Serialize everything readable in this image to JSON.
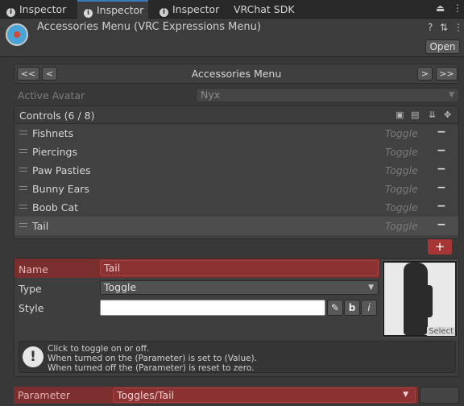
{
  "tabs": [
    {
      "label": "Inspector",
      "icon": "info-icon"
    },
    {
      "label": "Inspector",
      "icon": "info-icon"
    },
    {
      "label": "Inspector",
      "icon": "info-icon"
    },
    {
      "label": "VRChat SDK"
    }
  ],
  "header": {
    "title": "Accessories Menu (VRC Expressions Menu)",
    "open_label": "Open"
  },
  "nav": {
    "first": "<<",
    "prev": "<",
    "title": "Accessories Menu",
    "next": ">",
    "last": ">>"
  },
  "avatar": {
    "label": "Active Avatar",
    "value": "Nyx"
  },
  "controls": {
    "label": "Controls (6 / 8)",
    "items": [
      {
        "name": "Fishnets",
        "type": "Toggle"
      },
      {
        "name": "Piercings",
        "type": "Toggle"
      },
      {
        "name": "Paw Pasties",
        "type": "Toggle"
      },
      {
        "name": "Bunny Ears",
        "type": "Toggle"
      },
      {
        "name": "Boob Cat",
        "type": "Toggle"
      },
      {
        "name": "Tail",
        "type": "Toggle"
      }
    ],
    "add_label": "+"
  },
  "detail": {
    "name_label": "Name",
    "name_value": "Tail",
    "type_label": "Type",
    "type_value": "Toggle",
    "style_label": "Style",
    "bold_label": "b",
    "italic_label": "i",
    "preview_select": "Select",
    "help_lines": [
      "Click to toggle on or off.",
      "When turned on the (Parameter) is set to (Value).",
      "When turned off the (Parameter) is reset to zero."
    ]
  },
  "parameter": {
    "label": "Parameter",
    "value": "Toggles/Tail"
  }
}
